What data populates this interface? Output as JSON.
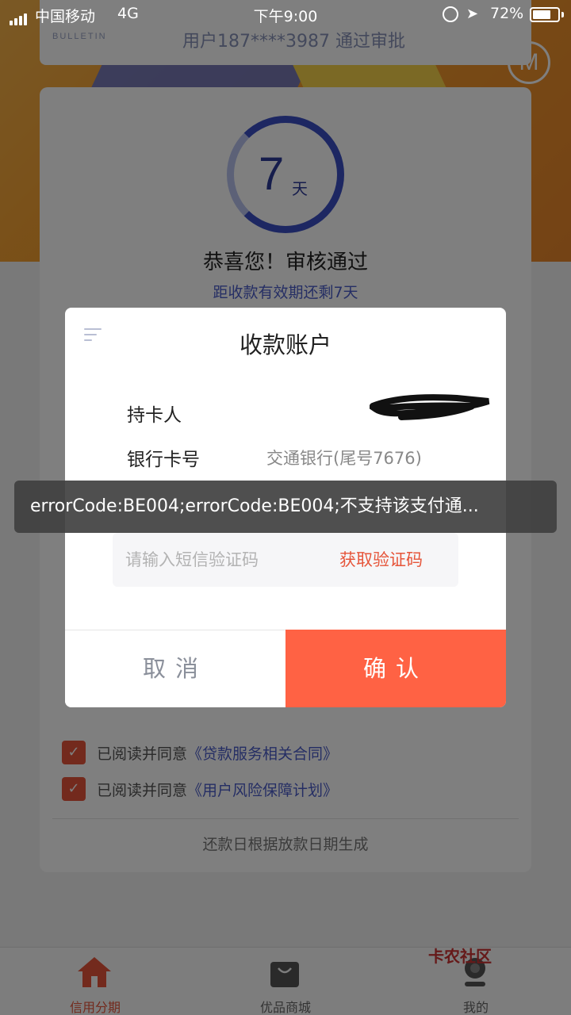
{
  "statusbar": {
    "carrier": "中国移动",
    "network": "4G",
    "time": "下午9:00",
    "battery_percent": "72%",
    "battery_level": 0.72
  },
  "bulletin": {
    "tag": "BULLETIN",
    "text": "用户187****3987 通过审批"
  },
  "card": {
    "days_number": "7",
    "days_unit": "天",
    "title": "恭喜您！审核通过",
    "subtitle": "距收款有效期还剩7天",
    "agreements": [
      {
        "prefix": "已阅读并同意",
        "link": "《贷款服务相关合同》"
      },
      {
        "prefix": "已阅读并同意",
        "link": "《用户风险保障计划》"
      }
    ],
    "footer": "还款日根据放款日期生成"
  },
  "dialog": {
    "title": "收款账户",
    "cardholder_label": "持卡人",
    "bank_card_label": "银行卡号",
    "bank_card_value": "交通银行(尾号7676)",
    "sms_placeholder": "请输入短信验证码",
    "get_code_label": "获取验证码",
    "cancel_label": "取消",
    "confirm_label": "确认"
  },
  "toast": {
    "message": "errorCode:BE004;errorCode:BE004;不支持该支付通..."
  },
  "tabbar": {
    "items": [
      {
        "label": "信用分期",
        "active": true
      },
      {
        "label": "优品商城",
        "active": false
      },
      {
        "label": "我的",
        "active": false
      }
    ]
  },
  "watermark": "卡农社区",
  "colors": {
    "accent": "#ff6244",
    "primary_blue": "#3a4fc4",
    "link_blue": "#4a5cc9"
  }
}
